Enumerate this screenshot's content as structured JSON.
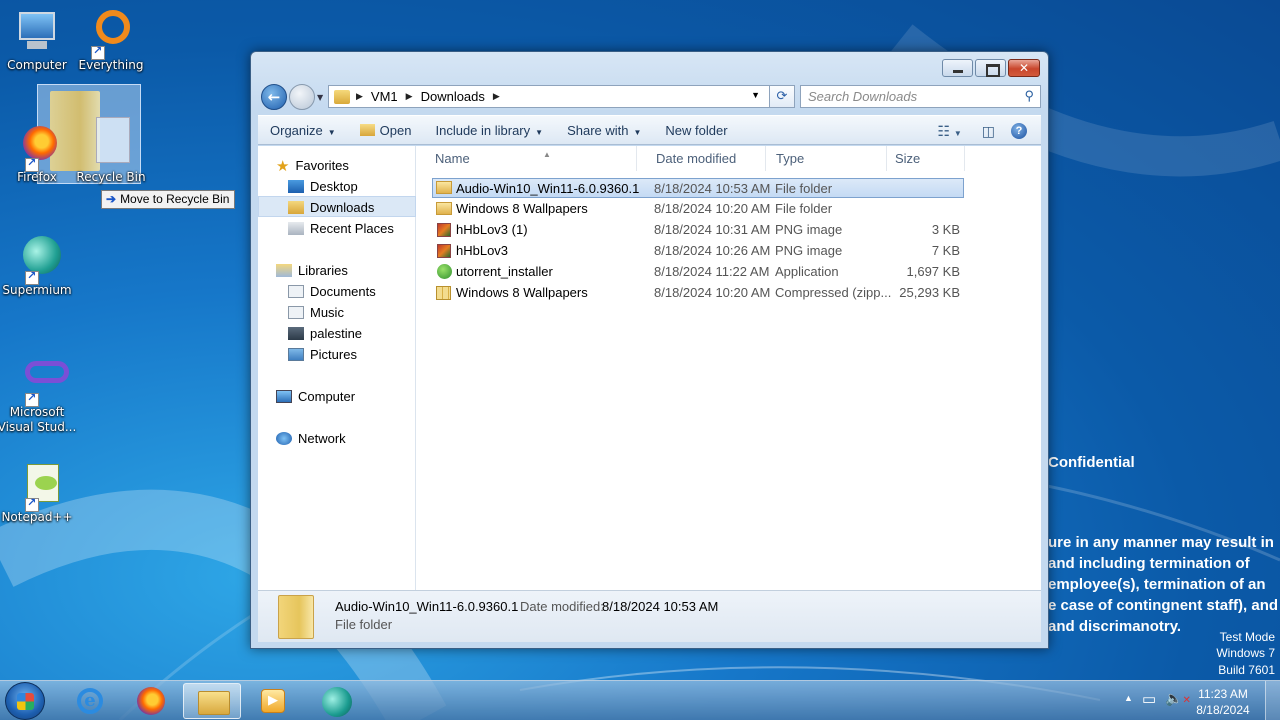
{
  "desktop": {
    "icons": [
      {
        "label": "Computer"
      },
      {
        "label": "Everything"
      },
      {
        "label": "Firefox"
      },
      {
        "label": "Recycle Bin"
      },
      {
        "label": "Supermium"
      },
      {
        "label": "Microsoft Visual Stud..."
      },
      {
        "label": "Notepad++"
      }
    ],
    "drag_tooltip": "Move to Recycle Bin",
    "confidential": {
      "title": "Confidential",
      "lines": [
        "ure in any manner may result in",
        "and including termination of",
        "employee(s), termination of an",
        "e case of contingnent staff), and",
        "and discrimanotry."
      ]
    },
    "test_mode": [
      "Test Mode",
      "Windows 7",
      "Build 7601"
    ]
  },
  "window": {
    "breadcrumb": [
      "VM1",
      "Downloads"
    ],
    "search_placeholder": "Search Downloads",
    "toolbar": {
      "organize": "Organize",
      "open": "Open",
      "include_in_library": "Include in library",
      "share_with": "Share with",
      "new_folder": "New folder"
    },
    "nav": {
      "favorites": "Favorites",
      "desktop": "Desktop",
      "downloads": "Downloads",
      "recent_places": "Recent Places",
      "libraries": "Libraries",
      "documents": "Documents",
      "music": "Music",
      "palestine": "palestine",
      "pictures": "Pictures",
      "computer": "Computer",
      "network": "Network"
    },
    "columns": {
      "name": "Name",
      "date": "Date modified",
      "type": "Type",
      "size": "Size"
    },
    "files": [
      {
        "name": "Audio-Win10_Win11-6.0.9360.1",
        "date": "8/18/2024 10:53 AM",
        "type": "File folder",
        "size": "",
        "icon": "folder-icon"
      },
      {
        "name": "Windows 8 Wallpapers",
        "date": "8/18/2024 10:20 AM",
        "type": "File folder",
        "size": "",
        "icon": "folder-icon"
      },
      {
        "name": "hHbLov3 (1)",
        "date": "8/18/2024 10:31 AM",
        "type": "PNG image",
        "size": "3 KB",
        "icon": "png-icon"
      },
      {
        "name": "hHbLov3",
        "date": "8/18/2024 10:26 AM",
        "type": "PNG image",
        "size": "7 KB",
        "icon": "png-icon"
      },
      {
        "name": "utorrent_installer",
        "date": "8/18/2024 11:22 AM",
        "type": "Application",
        "size": "1,697 KB",
        "icon": "app-icon"
      },
      {
        "name": "Windows 8 Wallpapers",
        "date": "8/18/2024 10:20 AM",
        "type": "Compressed (zipp...",
        "size": "25,293 KB",
        "icon": "zip-icon"
      }
    ],
    "details": {
      "name": "Audio-Win10_Win11-6.0.9360.1",
      "date_label": "Date modified:",
      "date_value": "8/18/2024 10:53 AM",
      "type": "File folder"
    }
  },
  "taskbar": {
    "clock_time": "11:23 AM",
    "clock_date": "8/18/2024"
  }
}
